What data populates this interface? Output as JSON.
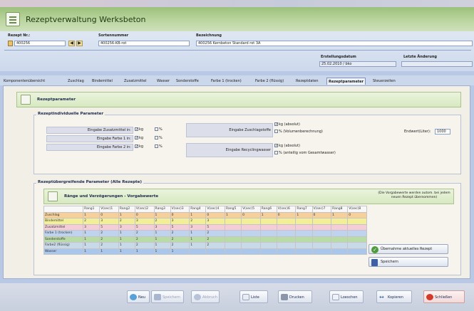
{
  "app": {
    "title": "Rezeptverwaltung Werksbeton"
  },
  "header": {
    "rezept_nr_label": "Rezept Nr.:",
    "rezept_nr_value": "400256",
    "sortennummer_label": "Sortennummer",
    "sortennummer_value": "400256-KB-rot",
    "bezeichnung_label": "Bezeichnung",
    "bezeichnung_value": "400256 Kernbeton Standard rot 3A",
    "erstellungsdatum_label": "Erstellungsdatum",
    "erstellungsdatum_value": "25.02.2010 / bko",
    "letzte_aenderung_label": "Letzte Änderung",
    "letzte_aenderung_value": ""
  },
  "tabs": [
    "Komponentenübersicht",
    "Zuschlag",
    "Bindemittel",
    "Zusatzmittel",
    "Wasser",
    "Sonderstoffe",
    "Farbe 1 (trocken)",
    "Farbe 2 (flüssig)",
    "Rezeptdaten",
    "Rezeptparameter",
    "Steuerzeiten"
  ],
  "section": {
    "title": "Rezeptparameter"
  },
  "individual": {
    "title": "Rezeptindividuelle Parameter",
    "rows": [
      {
        "label": "Eingabe Zusatzmittel in:",
        "opt1": "kg",
        "opt2": "%"
      },
      {
        "label": "Eingabe Farbe 1 in:",
        "opt1": "kg",
        "opt2": "%"
      },
      {
        "label": "Eingabe Farbe 2 in:",
        "opt1": "kg",
        "opt2": "%"
      }
    ],
    "zuschlag_label": "Eingabe Zuschlagstoffe",
    "zuschlag_opt1": "kg (absolut)",
    "zuschlag_opt2": "% (Volumenberechnung)",
    "endwert_label": "Endwert(Liter):",
    "endwert_value": "1000",
    "recycling_label": "Eingabe Recyclingwasser",
    "recycling_opt1": "kg (absolut)",
    "recycling_opt2": "% (anteilig vom Gesamtwasser)"
  },
  "overall": {
    "title": "Rezeptübergreifende Parameter (Alle Rezepte)",
    "subtitle": "Ränge und Verzögerungen - Vorgabewerte",
    "note": "(Die Vorgabewerte werden autom. bei jedem neuen Rezept übernommen)",
    "columns": [
      "",
      "Rang1",
      "V(sec)1",
      "Rang2",
      "V(sec)2",
      "Rang3",
      "V(sec)3",
      "Rang4",
      "V(sec)4",
      "Rang5",
      "V(sec)5",
      "Rang6",
      "V(sec)6",
      "Rang7",
      "V(sec)7",
      "Rang8",
      "V(sec)8"
    ],
    "rows": [
      {
        "name": "Zuschlag",
        "color": "#f7cf9a",
        "cells": [
          "1",
          "0",
          "1",
          "0",
          "1",
          "0",
          "1",
          "0",
          "1",
          "0",
          "1",
          "0",
          "1",
          "0",
          "1",
          "0"
        ]
      },
      {
        "name": "Bindemittel",
        "color": "#f3ef99",
        "cells": [
          "2",
          "3",
          "2",
          "3",
          "2",
          "3",
          "2",
          "3",
          "",
          "",
          "",
          "",
          "",
          "",
          "",
          ""
        ]
      },
      {
        "name": "Zusatzmittel",
        "color": "#f5cdd8",
        "cells": [
          "3",
          "5",
          "3",
          "5",
          "3",
          "5",
          "3",
          "5",
          "",
          "",
          "",
          "",
          "",
          "",
          "",
          ""
        ]
      },
      {
        "name": "Farbe 1 (trocken)",
        "color": "#bfd3ee",
        "cells": [
          "1",
          "2",
          "1",
          "2",
          "1",
          "2",
          "1",
          "2",
          "",
          "",
          "",
          "",
          "",
          "",
          "",
          ""
        ]
      },
      {
        "name": "Sonderstoffe",
        "color": "#b9dba5",
        "cells": [
          "1",
          "2",
          "1",
          "2",
          "1",
          "2",
          "1",
          "2",
          "",
          "",
          "",
          "",
          "",
          "",
          "",
          ""
        ]
      },
      {
        "name": "Farbe2 (flüssig)",
        "color": "#c8d9ea",
        "cells": [
          "1",
          "2",
          "1",
          "2",
          "1",
          "2",
          "1",
          "2",
          "",
          "",
          "",
          "",
          "",
          "",
          "",
          ""
        ]
      },
      {
        "name": "Wasser",
        "color": "#a9c7ec",
        "cells": [
          "1",
          "1",
          "1",
          "1",
          "1",
          "1",
          "",
          "",
          "",
          "",
          "",
          "",
          "",
          "",
          "",
          ""
        ]
      }
    ],
    "btn_uebernahme": "Übernahme aktuelles Rezept",
    "btn_speichern": "Speichern"
  },
  "toolbar": {
    "neu": "Neu",
    "speichern": "Speichern",
    "abbruch": "Abbruch",
    "liste": "Liste",
    "drucken": "Drucken",
    "loeschen": "Loeschen",
    "kopieren": "Kopieren",
    "schliessen": "Schließen"
  }
}
